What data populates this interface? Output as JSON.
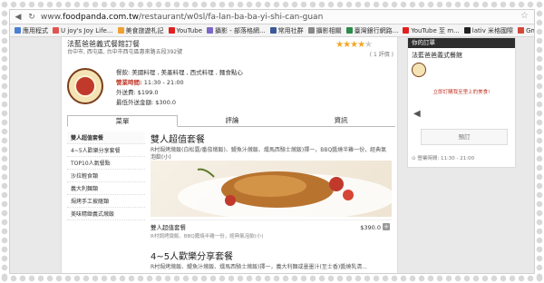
{
  "browser": {
    "url_prefix": "www.",
    "url_domain": "foodpanda.com.tw",
    "url_path": "/restaurant/w0sl/fa-lan-ba-ba-yi-shi-can-guan",
    "bookmarks": [
      {
        "label": "應用程式",
        "color": "#4a7fd4"
      },
      {
        "label": "U joy's Joy Life...",
        "color": "#e0544f"
      },
      {
        "label": "美食旅遊札記",
        "color": "#f0a030"
      },
      {
        "label": "YouTube",
        "color": "#e02020"
      },
      {
        "label": "攝影 - 部落格網...",
        "color": "#7b68c8"
      },
      {
        "label": "常用社群",
        "color": "#3b5998"
      },
      {
        "label": "攝影相關",
        "color": "#888888"
      },
      {
        "label": "臺灣銀行網路...",
        "color": "#2c8a4a"
      },
      {
        "label": "YouTube 至 m...",
        "color": "#e02020"
      },
      {
        "label": "lativ 米格國際",
        "color": "#222222"
      },
      {
        "label": "Gmail",
        "color": "#d44638"
      }
    ]
  },
  "restaurant": {
    "title": "法藍爸爸義式餐館訂餐",
    "address": "台中市, 西屯區, 台中市西屯區惠來路五段392號",
    "rating_stars": 4,
    "rating_max": 5,
    "reviews": "( 1 評價 )",
    "cuisine": "餐飲: 美國料理 , 美墨料理 , 西式料理 , 麵食點心",
    "hours_label": "營業時間:",
    "hours": "11:30 - 21:00",
    "delivery_fee_label": "外送費:",
    "delivery_fee": "$199.0",
    "min_order_label": "最低外送金額:",
    "min_order": "$300.0"
  },
  "tabs": [
    "菜單",
    "評論",
    "資訊"
  ],
  "categories": [
    "雙人超值套餐",
    "4~5人歡樂分享套餐",
    "TOP10人氣餐點",
    "沙拉輕食類",
    "義大利麵類",
    "焗烤手工披薩類",
    "美味精緻義式燉飯"
  ],
  "section1": {
    "title": "雙人超值套餐",
    "desc": "R村焗烤燉飯(白松露/番茄燉飯)、鯷魚汁燉飯、燻馬西騎士燉飯)擇一，BBQ醬燒半雞一份，經典氣泡飲(小)"
  },
  "item": {
    "name": "雙人超值套餐",
    "desc": "R村焗烤燉飯、BBQ醬燒半雞一份，經典氣泡飲(小)",
    "price": "$390.0",
    "add": "+"
  },
  "section2": {
    "title": "4~5人歡樂分享套餐",
    "desc": "R村焗烤燉飯、鯷魚汁燉飯、燻馬西騎士燉飯)擇一，義大利麵或墨墨汁(至士香)醬燒乳清..."
  },
  "cart": {
    "header": "你的訂單",
    "name": "法藍爸爸義式餐館",
    "message": "立即訂購我至里上的美食!",
    "checkout": "預訂",
    "delivery": "⊙ 營業時間: 11:30 - 21:00"
  }
}
